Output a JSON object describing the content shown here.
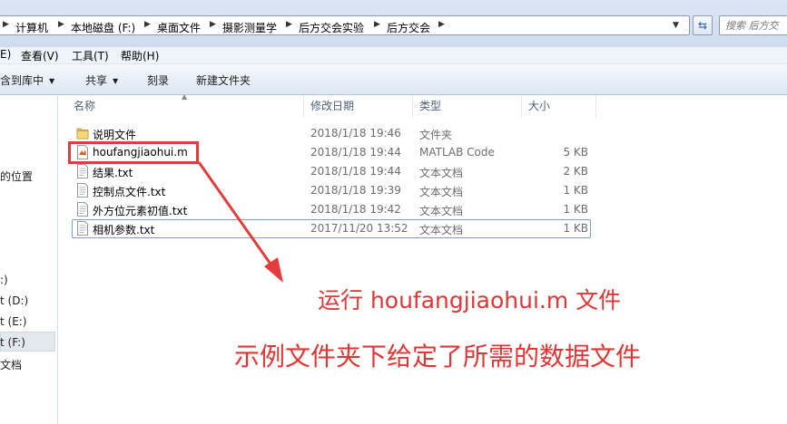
{
  "breadcrumb": {
    "items": [
      "计算机",
      "本地磁盘 (F:)",
      "桌面文件",
      "摄影测量学",
      "后方交会实验",
      "后方交会"
    ]
  },
  "search": {
    "placeholder": "搜索 后方交"
  },
  "menu": {
    "items": [
      "E)",
      "查看(V)",
      "工具(T)",
      "帮助(H)"
    ]
  },
  "commands": {
    "include_library": "含到库中",
    "share": "共享",
    "burn": "刻录",
    "new_folder": "新建文件夹"
  },
  "nav": {
    "items": [
      "的位置",
      ":)",
      "t (D:)",
      "t (E:)",
      "t (F:)",
      "文档"
    ]
  },
  "columns": {
    "name": "名称",
    "date": "修改日期",
    "type": "类型",
    "size": "大小"
  },
  "files": [
    {
      "name": "说明文件",
      "date": "2018/1/18 19:46",
      "type": "文件夹",
      "size": "",
      "icon": "folder-icon"
    },
    {
      "name": "houfangjiaohui.m",
      "date": "2018/1/18 19:44",
      "type": "MATLAB Code",
      "size": "5 KB",
      "icon": "matlab-file-icon"
    },
    {
      "name": "结果.txt",
      "date": "2018/1/18 19:44",
      "type": "文本文档",
      "size": "2 KB",
      "icon": "text-file-icon"
    },
    {
      "name": "控制点文件.txt",
      "date": "2018/1/18 19:39",
      "type": "文本文档",
      "size": "1 KB",
      "icon": "text-file-icon"
    },
    {
      "name": "外方位元素初值.txt",
      "date": "2018/1/18 19:42",
      "type": "文本文档",
      "size": "1 KB",
      "icon": "text-file-icon"
    },
    {
      "name": "相机参数.txt",
      "date": "2017/11/20 13:52",
      "type": "文本文档",
      "size": "1 KB",
      "icon": "text-file-icon"
    }
  ],
  "annotation": {
    "line1": "运行 houfangjiaohui.m 文件",
    "line2": "示例文件夹下给定了所需的数据文件",
    "color": "#e23535"
  }
}
